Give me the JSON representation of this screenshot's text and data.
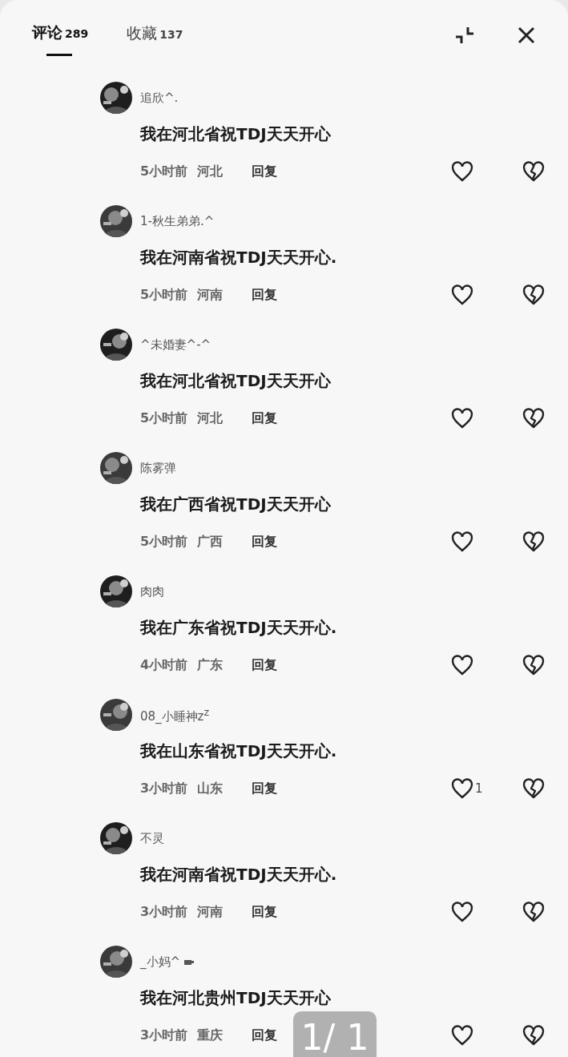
{
  "tabs": [
    {
      "label": "评论",
      "count": "289",
      "selected": true
    },
    {
      "label": "收藏",
      "count": "137",
      "selected": false
    }
  ],
  "comments": [
    {
      "user": "追欣^.",
      "text": "我在河北省祝TDJ天天开心",
      "time": "5小时前",
      "location": "河北",
      "reply": "回复",
      "has_emoji": false
    },
    {
      "user": "1-秋生弟弟.^",
      "text": "我在河南省祝TDJ天天开心.",
      "time": "5小时前",
      "location": "河南",
      "reply": "回复",
      "has_emoji": false
    },
    {
      "user": "^未婚妻^-^",
      "text": "我在河北省祝TDJ天天开心",
      "time": "5小时前",
      "location": "河北",
      "reply": "回复",
      "has_emoji": false
    },
    {
      "user": "陈雾弹",
      "text": "我在广西省祝TDJ天天开心",
      "time": "5小时前",
      "location": "广西",
      "reply": "回复",
      "has_emoji": false
    },
    {
      "user": "肉肉",
      "text": "我在广东省祝TDJ天天开心.",
      "time": "4小时前",
      "location": "广东",
      "reply": "回复",
      "has_emoji": false
    },
    {
      "user": "08_小睡神z$^{z}$",
      "text": "我在山东省祝TDJ天天开心.",
      "time": "3小时前",
      "location": "山东",
      "reply": "回复",
      "like_count": "1",
      "has_emoji": false
    },
    {
      "user": "不灵",
      "text": "我在河南省祝TDJ天天开心.",
      "time": "3小时前",
      "location": "河南",
      "reply": "回复",
      "has_emoji": false
    },
    {
      "user": "_小妈^",
      "text": "我在河北贵州TDJ天天开心",
      "time": "3小时前",
      "location": "重庆",
      "reply": "回复",
      "has_emoji": true
    }
  ],
  "page_counter": "1/ 1"
}
